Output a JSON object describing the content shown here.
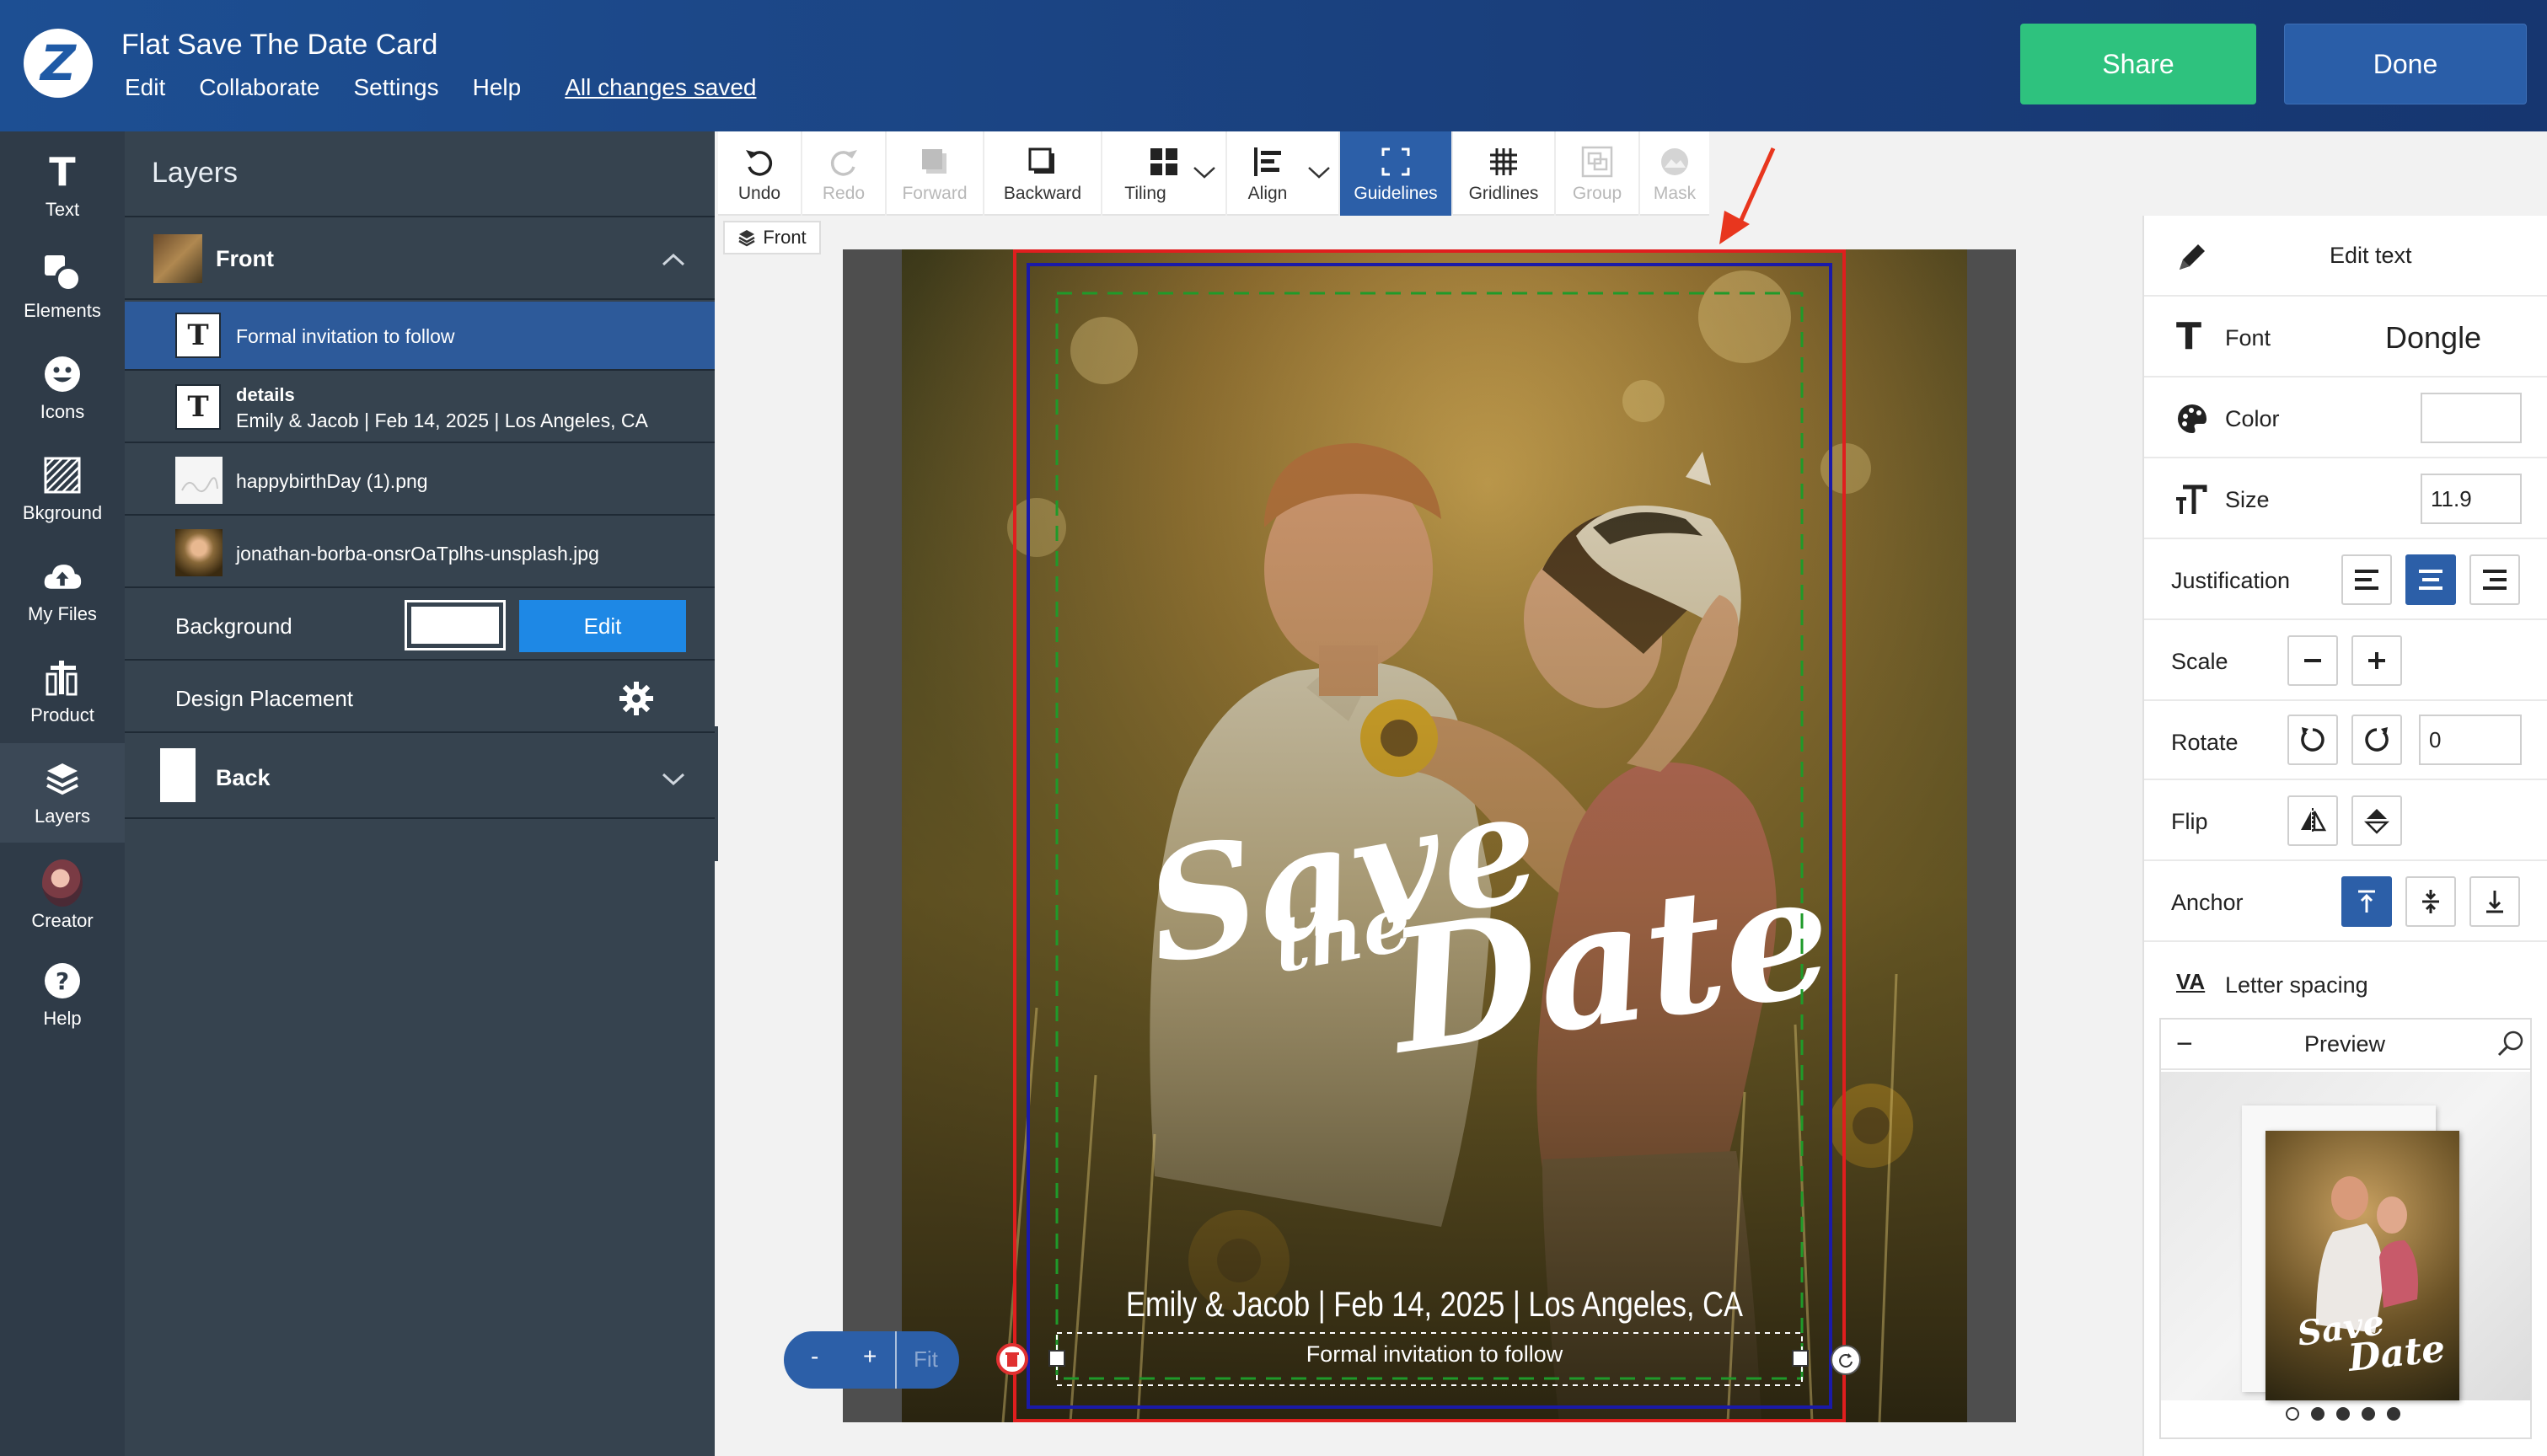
{
  "header": {
    "app_title": "Flat Save The Date Card",
    "menu": [
      "Edit",
      "Collaborate",
      "Settings",
      "Help"
    ],
    "save_status": "All changes saved",
    "share_label": "Share",
    "done_label": "Done"
  },
  "rail": {
    "items": [
      {
        "label": "Text",
        "icon": "text-icon"
      },
      {
        "label": "Elements",
        "icon": "elements-icon"
      },
      {
        "label": "Icons",
        "icon": "smiley-icon"
      },
      {
        "label": "Bkground",
        "icon": "background-icon"
      },
      {
        "label": "My Files",
        "icon": "cloud-upload-icon"
      },
      {
        "label": "Product",
        "icon": "product-icon"
      },
      {
        "label": "Layers",
        "icon": "layers-icon"
      },
      {
        "label": "Creator",
        "icon": "avatar-icon"
      },
      {
        "label": "Help",
        "icon": "help-icon"
      }
    ]
  },
  "layers": {
    "title": "Layers",
    "front_label": "Front",
    "items": [
      {
        "title": "",
        "subtitle": "Formal invitation to follow",
        "type": "text"
      },
      {
        "title": "details",
        "subtitle": "Emily & Jacob | Feb 14, 2025 | Los Angeles, CA",
        "type": "text"
      },
      {
        "title": "",
        "subtitle": "happybirthDay (1).png",
        "type": "image"
      },
      {
        "title": "",
        "subtitle": "jonathan-borba-onsrOaTplhs-unsplash.jpg",
        "type": "image"
      }
    ],
    "background_label": "Background",
    "background_color": "#ffffff",
    "edit_label": "Edit",
    "design_placement_label": "Design Placement",
    "back_label": "Back"
  },
  "toolbar": {
    "tools": [
      {
        "label": "Undo",
        "icon": "undo-icon",
        "state": "enabled"
      },
      {
        "label": "Redo",
        "icon": "redo-icon",
        "state": "disabled"
      },
      {
        "label": "Forward",
        "icon": "bring-forward-icon",
        "state": "disabled"
      },
      {
        "label": "Backward",
        "icon": "send-backward-icon",
        "state": "enabled"
      },
      {
        "label": "Tiling",
        "icon": "tiling-icon",
        "state": "enabled"
      },
      {
        "label": "Align",
        "icon": "align-icon",
        "state": "enabled"
      },
      {
        "label": "Guidelines",
        "icon": "guidelines-icon",
        "state": "active"
      },
      {
        "label": "Gridlines",
        "icon": "gridlines-icon",
        "state": "enabled"
      },
      {
        "label": "Group",
        "icon": "group-icon",
        "state": "disabled"
      },
      {
        "label": "Mask",
        "icon": "mask-icon",
        "state": "disabled"
      }
    ]
  },
  "canvas": {
    "side_tag": "Front",
    "headline_line1": "Save",
    "headline_line2": "the",
    "headline_line3": "Date",
    "details_text": "Emily & Jacob | Feb 14, 2025 | Los Angeles, CA",
    "selected_text": "Formal invitation to follow",
    "zoom_minus": "-",
    "zoom_plus": "+",
    "zoom_fit": "Fit"
  },
  "properties": {
    "edit_text_label": "Edit text",
    "font_label": "Font",
    "font_value": "Dongle",
    "color_label": "Color",
    "color_value": "#ffffff",
    "size_label": "Size",
    "size_value": "11.9",
    "justification_label": "Justification",
    "justification_selected": "center",
    "scale_label": "Scale",
    "rotate_label": "Rotate",
    "rotate_value": "0",
    "flip_label": "Flip",
    "anchor_label": "Anchor",
    "anchor_selected": "top",
    "letter_spacing_label": "Letter spacing",
    "letter_spacing_icon_text": "VA"
  },
  "preview": {
    "title": "Preview",
    "collapse_symbol": "−",
    "dots_count": 5,
    "active_dot": 0
  }
}
